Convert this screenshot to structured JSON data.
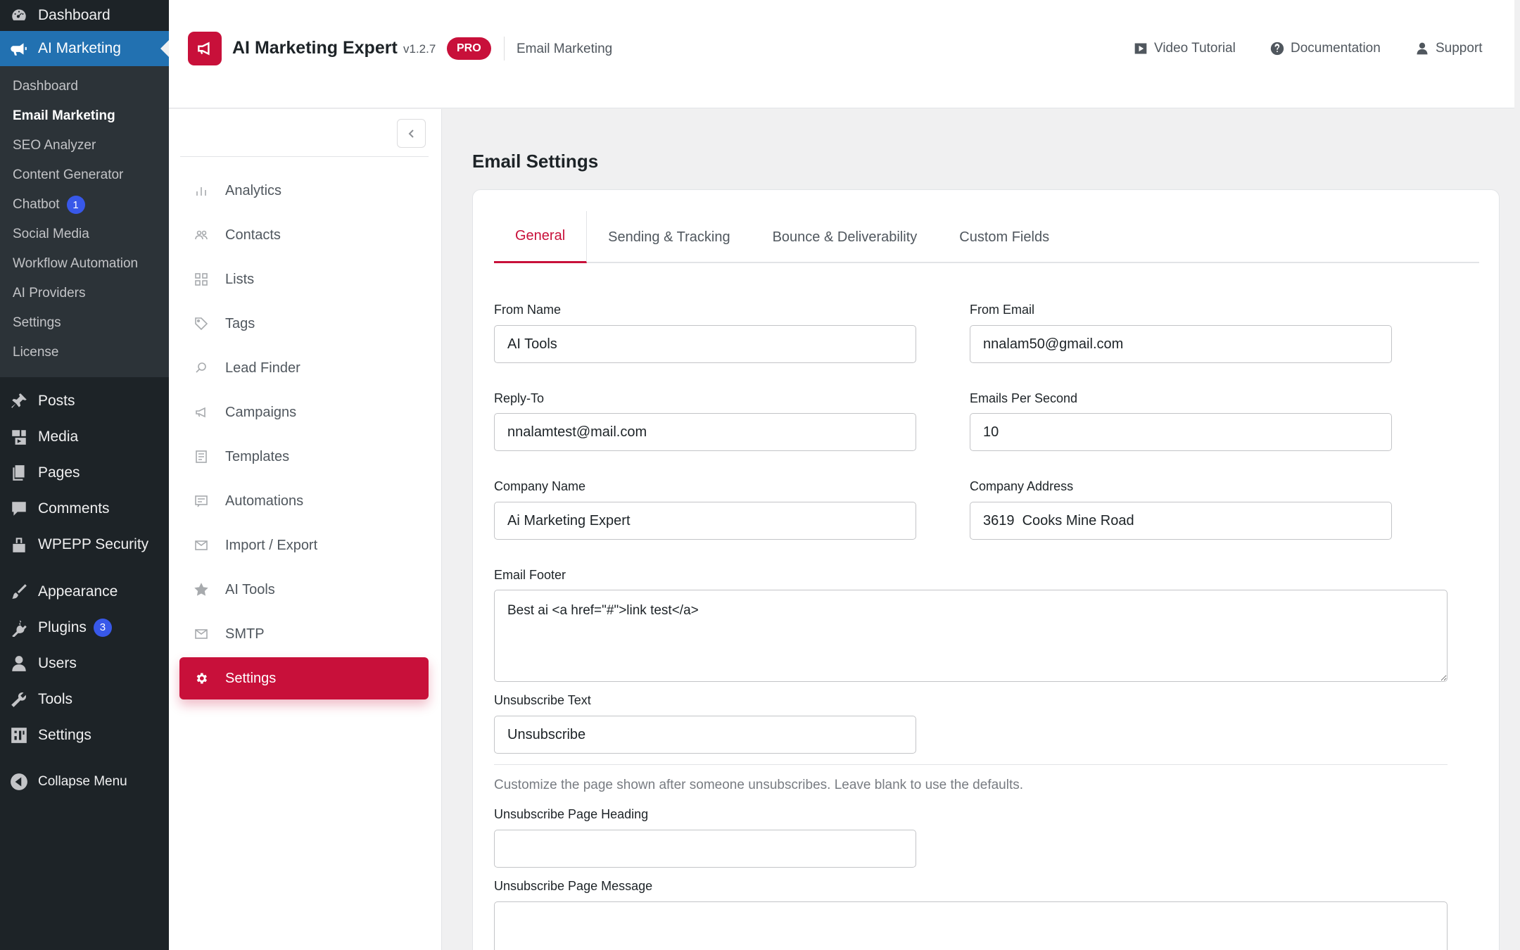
{
  "wp_sidebar": {
    "dashboard_label": "Dashboard",
    "plugin_label": "AI Marketing",
    "submenu": [
      {
        "label": "Dashboard"
      },
      {
        "label": "Email Marketing"
      },
      {
        "label": "SEO Analyzer"
      },
      {
        "label": "Content Generator"
      },
      {
        "label": "Chatbot",
        "badge": "1"
      },
      {
        "label": "Social Media"
      },
      {
        "label": "Workflow Automation"
      },
      {
        "label": "AI Providers"
      },
      {
        "label": "Settings"
      },
      {
        "label": "License"
      }
    ],
    "menu": [
      {
        "label": "Posts",
        "icon": "pin-icon"
      },
      {
        "label": "Media",
        "icon": "media-icon"
      },
      {
        "label": "Pages",
        "icon": "pages-icon"
      },
      {
        "label": "Comments",
        "icon": "comment-icon"
      },
      {
        "label": "WPEPP Security",
        "icon": "lock-icon"
      },
      {
        "label": "Appearance",
        "icon": "brush-icon"
      },
      {
        "label": "Plugins",
        "icon": "plugin-icon",
        "badge": "3"
      },
      {
        "label": "Users",
        "icon": "user-icon"
      },
      {
        "label": "Tools",
        "icon": "wrench-icon"
      },
      {
        "label": "Settings",
        "icon": "settings-icon"
      }
    ],
    "collapse_label": "Collapse Menu"
  },
  "header": {
    "app_title": "AI Marketing Expert",
    "version": "v1.2.7",
    "pro_badge": "PRO",
    "breadcrumb": "Email Marketing",
    "links": {
      "video_tutorial": "Video Tutorial",
      "documentation": "Documentation",
      "support": "Support"
    }
  },
  "plugin_nav": {
    "items": [
      {
        "label": "Analytics",
        "icon": "bar-chart-icon"
      },
      {
        "label": "Contacts",
        "icon": "contacts-icon"
      },
      {
        "label": "Lists",
        "icon": "grid-icon"
      },
      {
        "label": "Tags",
        "icon": "tag-icon"
      },
      {
        "label": "Lead Finder",
        "icon": "search-icon"
      },
      {
        "label": "Campaigns",
        "icon": "megaphone-icon"
      },
      {
        "label": "Templates",
        "icon": "document-icon"
      },
      {
        "label": "Automations",
        "icon": "automation-icon"
      },
      {
        "label": "Import / Export",
        "icon": "mail-icon"
      },
      {
        "label": "AI Tools",
        "icon": "star-icon"
      },
      {
        "label": "SMTP",
        "icon": "envelope-icon"
      },
      {
        "label": "Settings",
        "icon": "gear-icon",
        "active": true
      }
    ]
  },
  "main": {
    "heading": "Email Settings",
    "tabs": [
      {
        "label": "General",
        "active": true
      },
      {
        "label": "Sending & Tracking"
      },
      {
        "label": "Bounce & Deliverability"
      },
      {
        "label": "Custom Fields"
      }
    ],
    "form": {
      "from_name": {
        "label": "From Name",
        "value": "AI Tools"
      },
      "from_email": {
        "label": "From Email",
        "value": "nnalam50@gmail.com"
      },
      "reply_to": {
        "label": "Reply-To",
        "value": "nnalamtest@mail.com"
      },
      "emails_per_second": {
        "label": "Emails Per Second",
        "value": "10"
      },
      "company_name": {
        "label": "Company Name",
        "value": "Ai Marketing Expert"
      },
      "company_address": {
        "label": "Company Address",
        "value": "3619  Cooks Mine Road"
      },
      "email_footer": {
        "label": "Email Footer",
        "value": "Best ai <a href=\"#\">link test</a>"
      },
      "unsubscribe_text": {
        "label": "Unsubscribe Text",
        "value": "Unsubscribe"
      },
      "unsubscribe_help": "Customize the page shown after someone unsubscribes. Leave blank to use the defaults.",
      "unsubscribe_page_heading": {
        "label": "Unsubscribe Page Heading",
        "value": ""
      },
      "unsubscribe_page_message": {
        "label": "Unsubscribe Page Message",
        "value": ""
      }
    }
  },
  "colors": {
    "wp_sidebar_bg": "#1d2327",
    "wp_active_blue": "#2271b1",
    "brand_red": "#c8103a"
  }
}
